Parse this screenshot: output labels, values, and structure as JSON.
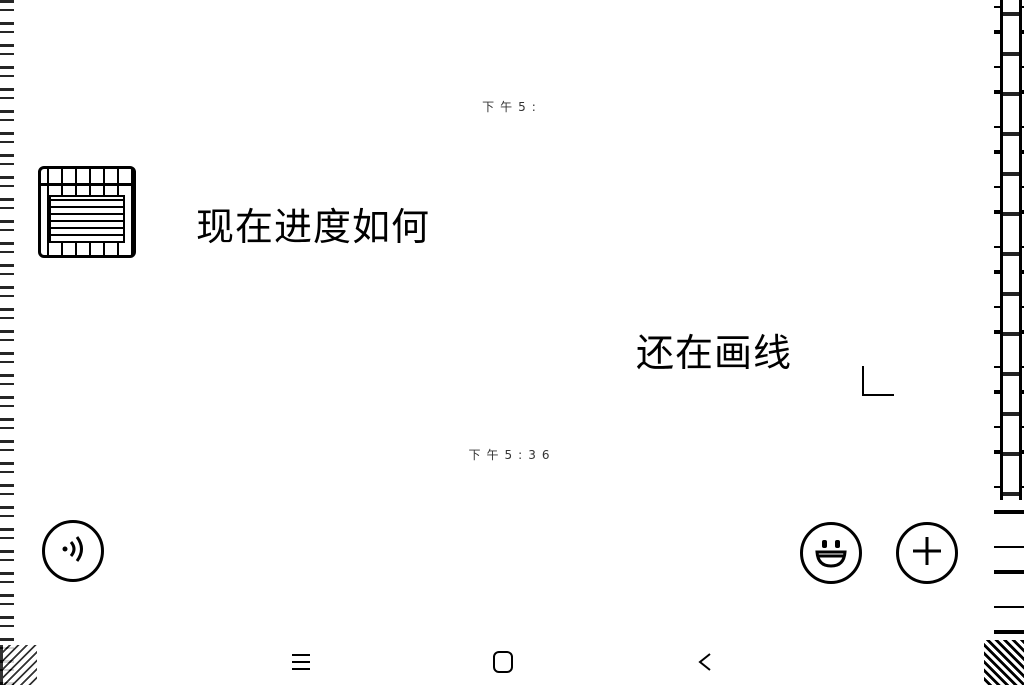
{
  "chat": {
    "timestamp_top": "下午5:",
    "timestamp_bottom": "下午5:36",
    "messages": [
      {
        "side": "left",
        "text": "现在进度如何"
      },
      {
        "side": "right",
        "text": "还在画线"
      }
    ]
  },
  "icons": {
    "voice": "voice-icon",
    "emoji": "emoji-icon",
    "plus": "plus-icon",
    "nav_menu": "menu-icon",
    "nav_home": "home-icon",
    "nav_back": "back-icon"
  },
  "colors": {
    "background": "#ffffff",
    "foreground": "#000000"
  }
}
